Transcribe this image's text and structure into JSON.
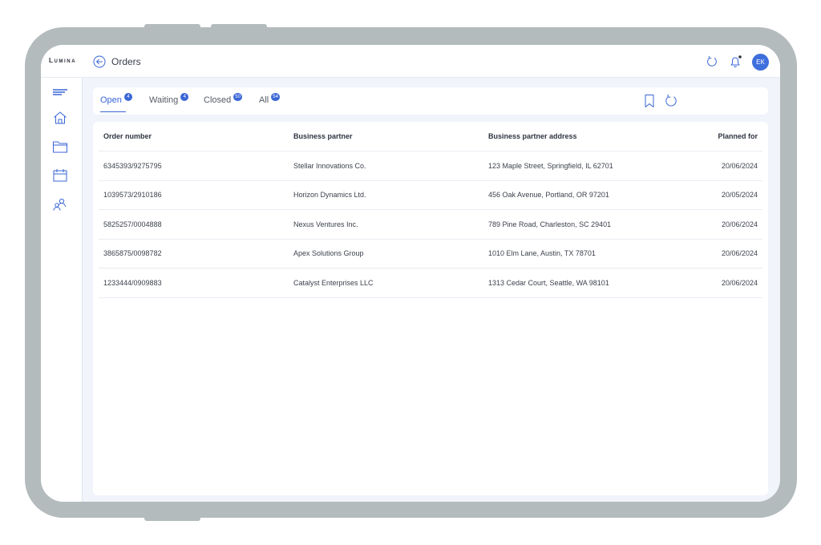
{
  "app": {
    "logo": "Lumina",
    "title": "Orders",
    "avatar_initials": "EK"
  },
  "colors": {
    "accent": "#3a66d6",
    "avatar": "#3f6fdc",
    "device_frame": "#b4bbbd",
    "screen_bg": "#f1f4fb"
  },
  "topbar_icons": [
    "refresh-icon",
    "bell-icon"
  ],
  "sidebar": {
    "items": [
      "menu-icon",
      "home-icon",
      "folder-icon",
      "calendar-icon",
      "users-icon"
    ]
  },
  "tabs": [
    {
      "label": "Open",
      "count": "4"
    },
    {
      "label": "Waiting",
      "count": "4"
    },
    {
      "label": "Closed",
      "count": "50"
    },
    {
      "label": "All",
      "count": "54"
    }
  ],
  "tab_actions": [
    "bookmark-icon",
    "refresh-icon"
  ],
  "table": {
    "headers": [
      "Order number",
      "Business partner",
      "Business partner address",
      "Planned for"
    ],
    "rows": [
      [
        "6345393/9275795",
        "Stellar Innovations Co.",
        "123 Maple Street, Springfield, IL 62701",
        "20/06/2024"
      ],
      [
        "1039573/2910186",
        "Horizon Dynamics Ltd.",
        "456 Oak Avenue, Portland, OR 97201",
        "20/05/2024"
      ],
      [
        "5825257/0004888",
        "Nexus Ventures Inc.",
        "789 Pine Road, Charleston, SC 29401",
        "20/06/2024"
      ],
      [
        "3865875/0098782",
        "Apex Solutions Group",
        "1010 Elm Lane, Austin, TX 78701",
        "20/06/2024"
      ],
      [
        "1233444/0909883",
        "Catalyst Enterprises LLC",
        "1313 Cedar Court, Seattle, WA 98101",
        "20/06/2024"
      ]
    ]
  }
}
